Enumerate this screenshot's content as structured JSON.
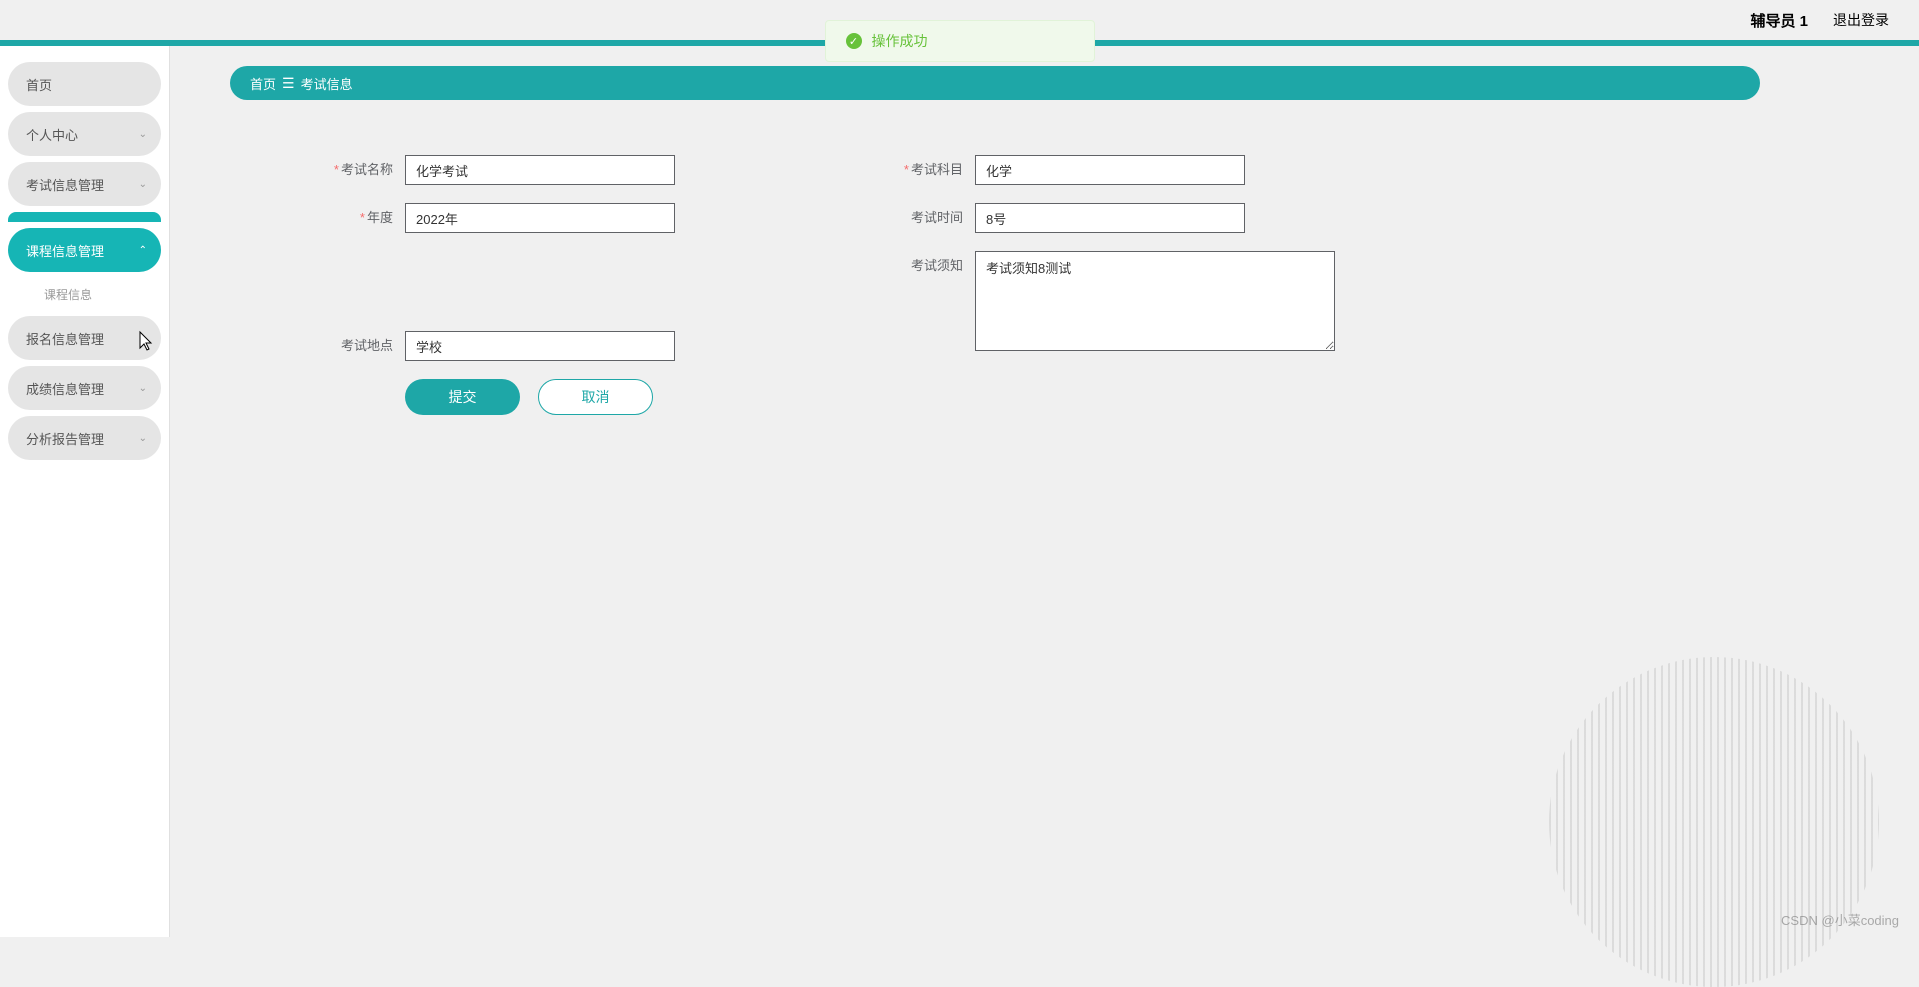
{
  "toast": {
    "message": "操作成功"
  },
  "header": {
    "user_name": "辅导员 1",
    "logout": "退出登录"
  },
  "breadcrumb": {
    "home": "首页",
    "current": "考试信息"
  },
  "sidebar": {
    "items": [
      {
        "label": "首页",
        "type": "simple"
      },
      {
        "label": "个人中心",
        "type": "expandable"
      },
      {
        "label": "考试信息管理",
        "type": "expandable"
      },
      {
        "label": "课程信息管理",
        "type": "expandable",
        "active": true
      },
      {
        "label": "报名信息管理",
        "type": "expandable"
      },
      {
        "label": "成绩信息管理",
        "type": "expandable"
      },
      {
        "label": "分析报告管理",
        "type": "expandable"
      }
    ],
    "sub_item": "课程信息"
  },
  "form": {
    "exam_name": {
      "label": "考试名称",
      "value": "化学考试",
      "required": true
    },
    "exam_subject": {
      "label": "考试科目",
      "value": "化学",
      "required": true
    },
    "year": {
      "label": "年度",
      "value": "2022年",
      "required": true
    },
    "exam_time": {
      "label": "考试时间",
      "value": "8号",
      "required": false
    },
    "exam_location": {
      "label": "考试地点",
      "value": "学校",
      "required": false
    },
    "exam_notice": {
      "label": "考试须知",
      "value": "考试须知8测试",
      "required": false
    }
  },
  "buttons": {
    "submit": "提交",
    "cancel": "取消"
  },
  "watermark": "CSDN @小菜coding"
}
